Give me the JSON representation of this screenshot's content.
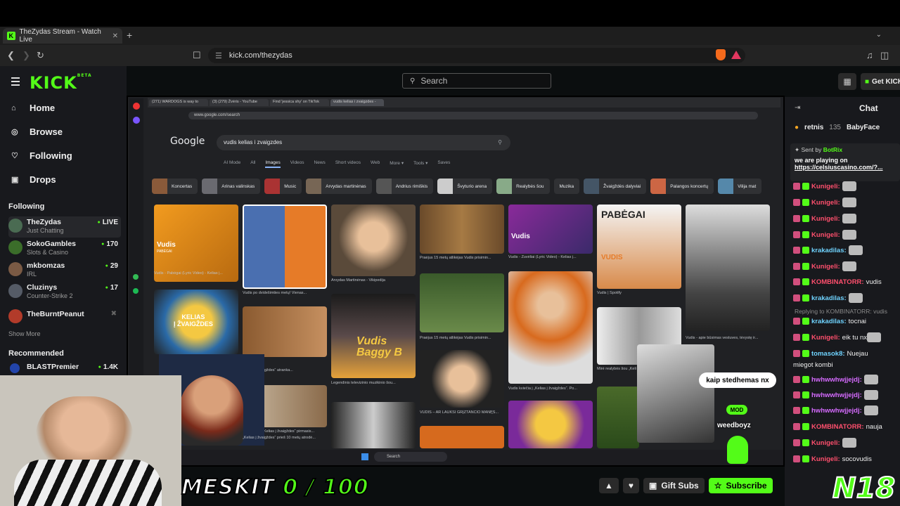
{
  "browser": {
    "tab_title": "TheZydas Stream - Watch Live",
    "tab_close": "✕",
    "new_tab": "+",
    "tab_menu": "⌄",
    "url": "kick.com/thezydas"
  },
  "kick": {
    "logo": "KICK",
    "logo_beta": "BETA",
    "search_placeholder": "Search",
    "get_kick": "Get KICK",
    "nav": [
      {
        "label": "Home",
        "icon": "home-icon",
        "glyph": "⌂"
      },
      {
        "label": "Browse",
        "icon": "browse-icon",
        "glyph": "◎"
      },
      {
        "label": "Following",
        "icon": "heart-icon",
        "glyph": "♡"
      },
      {
        "label": "Drops",
        "icon": "drops-icon",
        "glyph": "▣"
      }
    ],
    "following_header": "Following",
    "following": [
      {
        "name": "TheZydas",
        "sub": "Just Chatting",
        "viewers": "LIVE",
        "color": "#4a6b52"
      },
      {
        "name": "SokoGambles",
        "sub": "Slots & Casino",
        "viewers": "170",
        "color": "#3b6d2a"
      },
      {
        "name": "mkbomzas",
        "sub": "IRL",
        "viewers": "29",
        "color": "#7a5a44"
      },
      {
        "name": "Cluzinys",
        "sub": "Counter-Strike 2",
        "viewers": "17",
        "color": "#555b66"
      },
      {
        "name": "TheBurntPeanut",
        "sub": "",
        "viewers": "",
        "color": "#b23b2a"
      }
    ],
    "show_more": "Show More",
    "recommended_header": "Recommended",
    "recommended": [
      {
        "name": "BLASTPremier",
        "viewers": "1.4K"
      }
    ]
  },
  "chat": {
    "title": "Chat",
    "kings": [
      {
        "name": "retnis",
        "count": "135"
      },
      {
        "name": "BabyFace"
      }
    ],
    "pinned": {
      "sent_by": "Sent by",
      "author": "BotRix",
      "message": "we are playing on",
      "link": "https://celsiuscasino.com/?..."
    },
    "replying": "Replying to KOMBINATORR: vudis",
    "messages": [
      {
        "user": "Kunigeli:",
        "text": "",
        "color": "#ff4f6d",
        "emote": true
      },
      {
        "user": "Kunigeli:",
        "text": "",
        "color": "#ff4f6d",
        "emote": true
      },
      {
        "user": "Kunigeli:",
        "text": "",
        "color": "#ff4f6d",
        "emote": true
      },
      {
        "user": "Kunigeli:",
        "text": "",
        "color": "#ff4f6d",
        "emote": true
      },
      {
        "user": "krakadilas:",
        "text": "",
        "color": "#6fd3ff",
        "emote": true
      },
      {
        "user": "Kunigeli:",
        "text": "",
        "color": "#ff4f6d",
        "emote": true
      },
      {
        "user": "KOMBINATORR:",
        "text": "vudis",
        "color": "#ff4f6d",
        "emote": false
      },
      {
        "user": "krakadilas:",
        "text": "",
        "color": "#6fd3ff",
        "emote": true
      },
      {
        "user": "krakadilas:",
        "text": "tocnai",
        "color": "#6fd3ff",
        "emote": false
      },
      {
        "user": "Kunigeli:",
        "text": "eik tu nx",
        "color": "#ff4f6d",
        "emote": true
      },
      {
        "user": "tomasok8:",
        "text": "Nuejau",
        "color": "#6fd3ff",
        "emote": false
      },
      {
        "user": "",
        "text": "miegot kombi",
        "color": "#eee",
        "emote": false
      },
      {
        "user": "hwhwwhwjjejdj:",
        "text": "",
        "color": "#d66bff",
        "emote": true
      },
      {
        "user": "hwhwwhwjjejdj:",
        "text": "",
        "color": "#d66bff",
        "emote": true
      },
      {
        "user": "hwhwwhwjjejdj:",
        "text": "",
        "color": "#d66bff",
        "emote": true
      },
      {
        "user": "KOMBINATORR:",
        "text": "nauja",
        "color": "#ff4f6d",
        "emote": false
      },
      {
        "user": "Kunigeli:",
        "text": "",
        "color": "#ff4f6d",
        "emote": true
      },
      {
        "user": "Kunigeli:",
        "text": "socovudis",
        "color": "#ff4f6d",
        "emote": false
      }
    ]
  },
  "stream": {
    "inner_tabs": [
      "(271) WARDOGS is way to",
      "(3) (279) Žvėris - YouTube",
      "Find 'jessica shy' on TikTok",
      "vudis kelias i zvaigzdes -"
    ],
    "inner_url": "www.google.com/search",
    "google_logo": "Google",
    "query": "vudis kelias i zvaigzdes",
    "gtabs": [
      "AI Mode",
      "All",
      "Images",
      "Videos",
      "News",
      "Short videos",
      "Web",
      "More ▾",
      "Tools ▾",
      "Saves"
    ],
    "chips": [
      "Koncertas",
      "Arinas valinskas",
      "Music",
      "Arvydas martinėnas",
      "Andrius rimiškis",
      "Švyturio arena",
      "Realybės šou",
      "Muzika",
      "Žvaigždės dalyviai",
      "Palangos koncertų",
      "Vilija mat"
    ],
    "captions": [
      "Vudis - Pabėgai (Lyric Video) - Kelias į...",
      "Vudis po dvidešimties metų! Vienas...",
      "Arvydas Martinėnas - Vikipedija",
      "Praėjus 15 metų atlikėjas Vudis prisimin...",
      "Vudis - Žuvėliai (Lyric Video) - Kelias į...",
      "Vudis | Spotify",
      "Vudis - apie būsimas vestuves, tėvystę ir...",
      "Praėjus 15 metų atlikėjas Vudis prisimin...",
      "„Kelias į žvaigždes“ atranka...",
      "Legendinis televizinio muzikinio šou...",
      "Vudis kviečia į „Kelias į žvaigždes“. Po...",
      "Mirė realybės šou „Kelias į žvaigždes“...",
      "VUDIS – AR LAUKSI GRĮŽTANČIO MANĘS...",
      "Legendinis „Kelias į žvaigždes“ pirmasis...",
      "„Kelias į žvaigždes“ prieš 10 metų atrodė..."
    ],
    "badge_text": "Vudis",
    "badge_sub": "PABĖGAI",
    "pabegai": "PABĖGAI",
    "vudis2": "VUDIS",
    "kelias_text": "KELIAS\nĮ ŽVAIGŽDES",
    "baggy": "Vudis\nBaggy B",
    "taskbar_search": "Search"
  },
  "overlays": {
    "goal": "MESKIT",
    "goal_progress": "0 / 100",
    "bubble": "kaip stedhemas nx",
    "mod": "MOD",
    "mod_user": "weedboyz",
    "n18": "N18",
    "gift_subs": "Gift Subs",
    "subscribe": "Subscribe"
  }
}
